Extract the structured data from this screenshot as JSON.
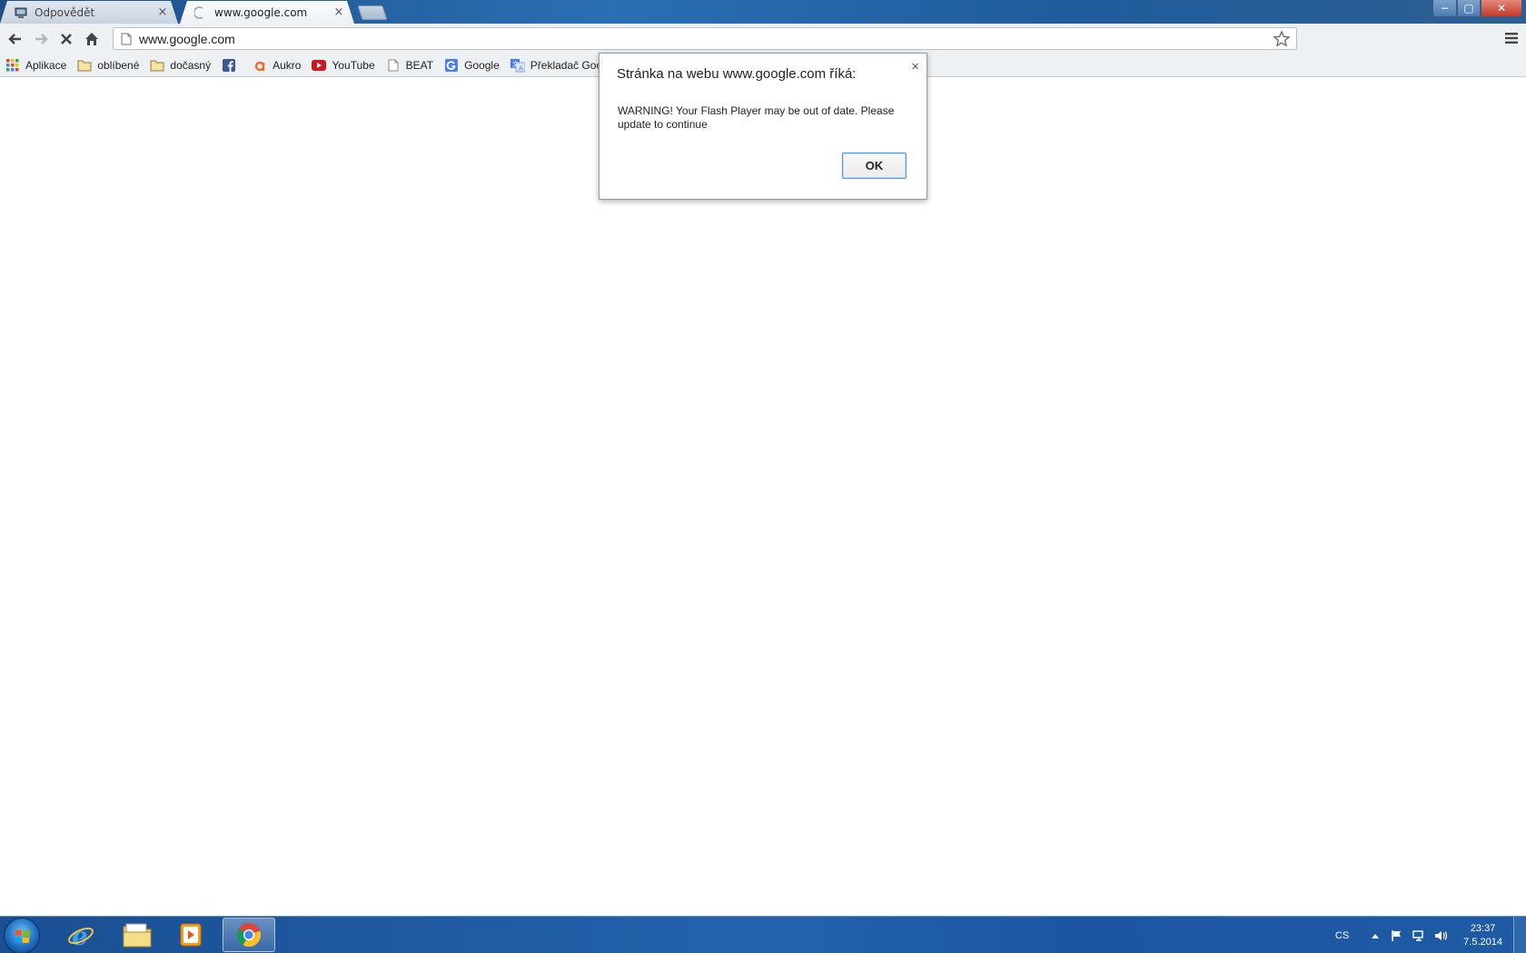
{
  "tabs": [
    {
      "label": "Odpovědět",
      "icon": "computer-icon",
      "active": false
    },
    {
      "label": "www.google.com",
      "icon": "loading-spinner-icon",
      "active": true
    }
  ],
  "tab_close_glyph": "×",
  "window_buttons": {
    "minimize": "−",
    "maximize": "▢",
    "close": "✕"
  },
  "address_bar": {
    "url": "www.google.com"
  },
  "bookmarks": [
    {
      "label": "Aplikace",
      "icon": "apps-grid-icon"
    },
    {
      "label": "oblíbené",
      "icon": "folder-icon"
    },
    {
      "label": "dočasný",
      "icon": "folder-icon"
    },
    {
      "label": "",
      "icon": "facebook-icon"
    },
    {
      "label": "Aukro",
      "icon": "aukro-icon"
    },
    {
      "label": "YouTube",
      "icon": "youtube-icon"
    },
    {
      "label": "BEAT",
      "icon": "page-icon"
    },
    {
      "label": "Google",
      "icon": "google-icon"
    },
    {
      "label": "Překladač Goog",
      "icon": "translate-icon"
    }
  ],
  "dialog": {
    "title": "Stránka na webu www.google.com říká:",
    "message": "WARNING! Your Flash Player may be out of date. Please update to continue",
    "ok_label": "OK",
    "close_glyph": "×"
  },
  "taskbar": {
    "language": "CS",
    "time": "23:37",
    "date": "7.5.2014"
  },
  "colors": {
    "titlebar": "#1d4f86",
    "taskbar": "#2363ad",
    "dialog_button_border": "#4d90fe"
  }
}
